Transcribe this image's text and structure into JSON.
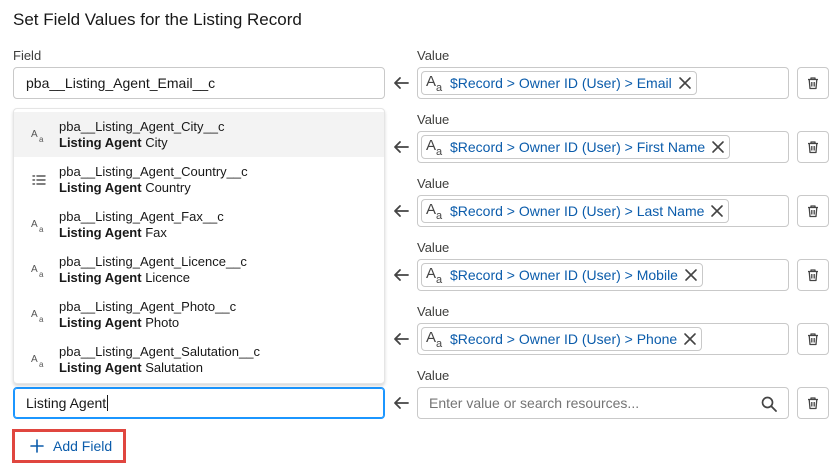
{
  "title": "Set Field Values for the Listing Record",
  "labels": {
    "field": "Field",
    "value": "Value"
  },
  "first_field": "pba__Listing_Agent_Email__c",
  "rows": [
    {
      "value_label": "Value",
      "pill": "$Record > Owner ID (User) > Email"
    },
    {
      "value_label": "Value",
      "pill": "$Record > Owner ID (User) > First Name"
    },
    {
      "value_label": "Value",
      "pill": "$Record > Owner ID (User) > Last Name"
    },
    {
      "value_label": "Value",
      "pill": "$Record > Owner ID (User) > Mobile"
    },
    {
      "value_label": "Value",
      "pill": "$Record > Owner ID (User) > Phone"
    },
    {
      "value_label": "Value"
    }
  ],
  "dropdown": [
    {
      "api": "pba__Listing_Agent_City__c",
      "bold": "Listing Agent",
      "rest": " City",
      "icon": "text-icon"
    },
    {
      "api": "pba__Listing_Agent_Country__c",
      "bold": "Listing Agent",
      "rest": " Country",
      "icon": "picklist-icon"
    },
    {
      "api": "pba__Listing_Agent_Fax__c",
      "bold": "Listing Agent",
      "rest": " Fax",
      "icon": "text-icon"
    },
    {
      "api": "pba__Listing_Agent_Licence__c",
      "bold": "Listing Agent",
      "rest": " Licence",
      "icon": "text-icon"
    },
    {
      "api": "pba__Listing_Agent_Photo__c",
      "bold": "Listing Agent",
      "rest": " Photo",
      "icon": "text-icon"
    },
    {
      "api": "pba__Listing_Agent_Salutation__c",
      "bold": "Listing Agent",
      "rest": " Salutation",
      "icon": "text-icon"
    }
  ],
  "search_field_value": "Listing Agent",
  "value_placeholder": "Enter value or search resources...",
  "add_field_label": "Add Field",
  "colors": {
    "link": "#0b5cab",
    "focus": "#1b96ff",
    "highlight_box": "#e0463f"
  }
}
